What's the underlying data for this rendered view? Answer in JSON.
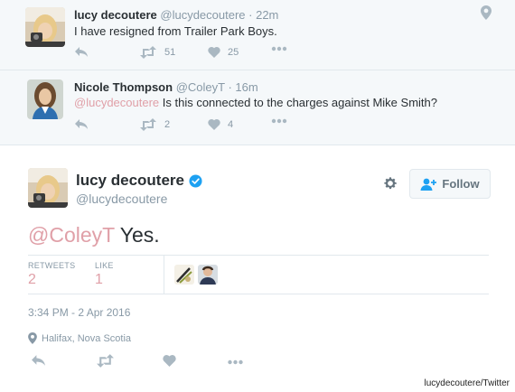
{
  "thread": [
    {
      "name": "lucy decoutere",
      "handle": "@lucydecoutere",
      "time": "· 22m",
      "text": "I have resigned from Trailer Park Boys.",
      "mention": "",
      "retweets": "51",
      "likes": "25"
    },
    {
      "name": "Nicole Thompson",
      "handle": "@ColeyT",
      "time": "· 16m",
      "mention": "@lucydecoutere",
      "text": "Is this connected to the charges against Mike Smith?",
      "retweets": "2",
      "likes": "4"
    }
  ],
  "main": {
    "name": "lucy decoutere",
    "handle": "@lucydecoutere",
    "follow_label": "Follow",
    "mention": "@ColeyT",
    "text": "Yes.",
    "retweets_label": "RETWEETS",
    "retweets": "2",
    "likes_label": "LIKE",
    "likes": "1",
    "datetime": "3:34 PM - 2 Apr 2016",
    "location": "Halifax, Nova Scotia"
  },
  "credit": "lucydecoutere/Twitter",
  "colors": {
    "mention": "#e0a0a8",
    "verified": "#1da1f2",
    "icon_gray": "#8899a6",
    "thread_bg": "#f5f8fa"
  },
  "icons": [
    "geo-pin-icon",
    "reply-icon",
    "retweet-icon",
    "heart-icon",
    "more-icon",
    "verified-badge-icon",
    "gear-icon",
    "follow-user-icon",
    "location-pin-icon"
  ]
}
